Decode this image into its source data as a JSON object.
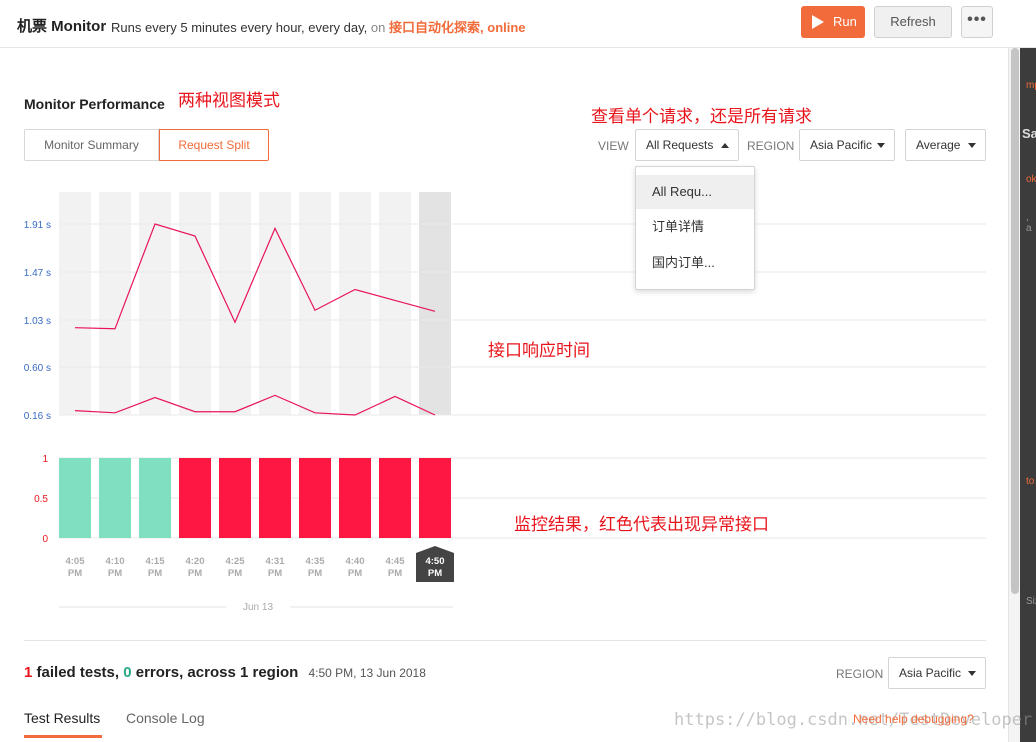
{
  "header": {
    "title": "机票 Monitor",
    "subtitle_prefix": "Runs every 5 minutes every hour, every day,",
    "subtitle_on": "on",
    "collection": "接口自动化探索,",
    "environment": "online",
    "run_label": "Run",
    "refresh_label": "Refresh",
    "more_label": "•••"
  },
  "right_edge_fragments": [
    "mp",
    "Sa",
    "ok",
    ", a",
    "to",
    "Siz"
  ],
  "performance": {
    "title": "Monitor Performance",
    "tabs": [
      {
        "label": "Monitor Summary",
        "active": false
      },
      {
        "label": "Request Split",
        "active": true
      }
    ],
    "view_label": "VIEW",
    "view_value": "All Requests",
    "region_label": "REGION",
    "region_value": "Asia Pacific",
    "aggregate_value": "Average",
    "dropdown_options": [
      "All Requ...",
      "订单详情",
      "国内订单..."
    ]
  },
  "annotations": {
    "view_modes": "两种视图模式",
    "single_or_all": "查看单个请求，还是所有请求",
    "response_time": "接口响应时间",
    "monitor_result": "监控结果，红色代表出现异常接口"
  },
  "chart_data": [
    {
      "type": "line",
      "title": "",
      "ylabel": "",
      "y_tick_labels": [
        "1.91 s",
        "1.47 s",
        "1.03 s",
        "0.60 s",
        "0.16 s"
      ],
      "y_ticks": [
        1.91,
        1.47,
        1.03,
        0.6,
        0.16
      ],
      "ylim": [
        0.16,
        1.91
      ],
      "categories": [
        "4:05 PM",
        "4:10 PM",
        "4:15 PM",
        "4:20 PM",
        "4:25 PM",
        "4:31 PM",
        "4:35 PM",
        "4:40 PM",
        "4:45 PM",
        "4:50 PM"
      ],
      "highlighted_category": "4:50 PM",
      "series": [
        {
          "values": [
            0.96,
            0.95,
            1.91,
            1.8,
            1.01,
            1.87,
            1.12,
            1.31,
            1.21,
            1.11
          ],
          "color": "#e8145a"
        },
        {
          "values": [
            0.2,
            0.18,
            0.32,
            0.19,
            0.19,
            0.34,
            0.18,
            0.16,
            0.33,
            0.16
          ],
          "color": "#e8145a"
        }
      ]
    },
    {
      "type": "bar",
      "title": "",
      "y_tick_labels": [
        "1",
        "0.5",
        "0"
      ],
      "ylim": [
        0,
        1
      ],
      "categories": [
        "4:05 PM",
        "4:10 PM",
        "4:15 PM",
        "4:20 PM",
        "4:25 PM",
        "4:31 PM",
        "4:35 PM",
        "4:40 PM",
        "4:45 PM",
        "4:50 PM"
      ],
      "x_tick_lines": [
        [
          "4:05",
          "PM"
        ],
        [
          "4:10",
          "PM"
        ],
        [
          "4:15",
          "PM"
        ],
        [
          "4:20",
          "PM"
        ],
        [
          "4:25",
          "PM"
        ],
        [
          "4:31",
          "PM"
        ],
        [
          "4:35",
          "PM"
        ],
        [
          "4:40",
          "PM"
        ],
        [
          "4:45",
          "PM"
        ],
        [
          "4:50",
          "PM"
        ]
      ],
      "values": [
        1,
        1,
        1,
        1,
        1,
        1,
        1,
        1,
        1,
        1
      ],
      "status": [
        "pass",
        "pass",
        "pass",
        "fail",
        "fail",
        "fail",
        "fail",
        "fail",
        "fail",
        "fail"
      ],
      "colors": {
        "pass": "#7fdfc0",
        "fail": "#ff1744"
      },
      "date_label": "Jun 13"
    }
  ],
  "results": {
    "failed_count": "1",
    "failed_text": "failed tests,",
    "error_count": "0",
    "error_text": "errors, across 1 region",
    "timestamp": "4:50 PM, 13 Jun 2018",
    "region_label": "REGION",
    "region_value": "Asia Pacific",
    "tabs": [
      "Test Results",
      "Console Log"
    ],
    "help_link": "Need help debugging?",
    "watermark": "https://blog.csdn.net/TestDeveloper"
  }
}
